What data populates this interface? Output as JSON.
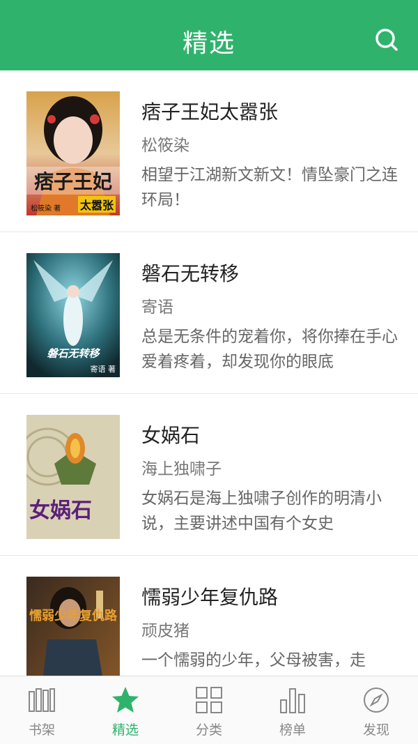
{
  "header": {
    "title": "精选"
  },
  "colors": {
    "brand": "#2fb36c",
    "inactive": "#888888"
  },
  "books": [
    {
      "title": "痞子王妃太嚣张",
      "author": "松筱染",
      "description": "相望于江湖新文新文！情坠豪门之连环局！",
      "cover": {
        "title": "痞子王妃",
        "subtitle": "太嚣张",
        "author": "松筱染 著"
      }
    },
    {
      "title": "磐石无转移",
      "author": "寄语",
      "description": "总是无条件的宠着你，将你捧在手心爱着疼着，却发现你的眼底",
      "cover": {
        "title": "磐石无转移",
        "subtitle": "寄语 著",
        "author": ""
      }
    },
    {
      "title": "女娲石",
      "author": "海上独啸子",
      "description": "女娲石是海上独啸子创作的明清小说，主要讲述中国有个女史",
      "cover": {
        "title": "女娲石",
        "subtitle": "",
        "author": ""
      }
    },
    {
      "title": "懦弱少年复仇路",
      "author": "顽皮猪",
      "description": "一个懦弱的少年，父母被害，走",
      "cover": {
        "title": "懦弱少年复仇路",
        "subtitle": "",
        "author": ""
      }
    }
  ],
  "tabs": [
    {
      "label": "书架",
      "icon": "bookshelf-icon",
      "active": false
    },
    {
      "label": "精选",
      "icon": "star-icon",
      "active": true
    },
    {
      "label": "分类",
      "icon": "grid-icon",
      "active": false
    },
    {
      "label": "榜单",
      "icon": "bar-chart-icon",
      "active": false
    },
    {
      "label": "发现",
      "icon": "compass-icon",
      "active": false
    }
  ]
}
